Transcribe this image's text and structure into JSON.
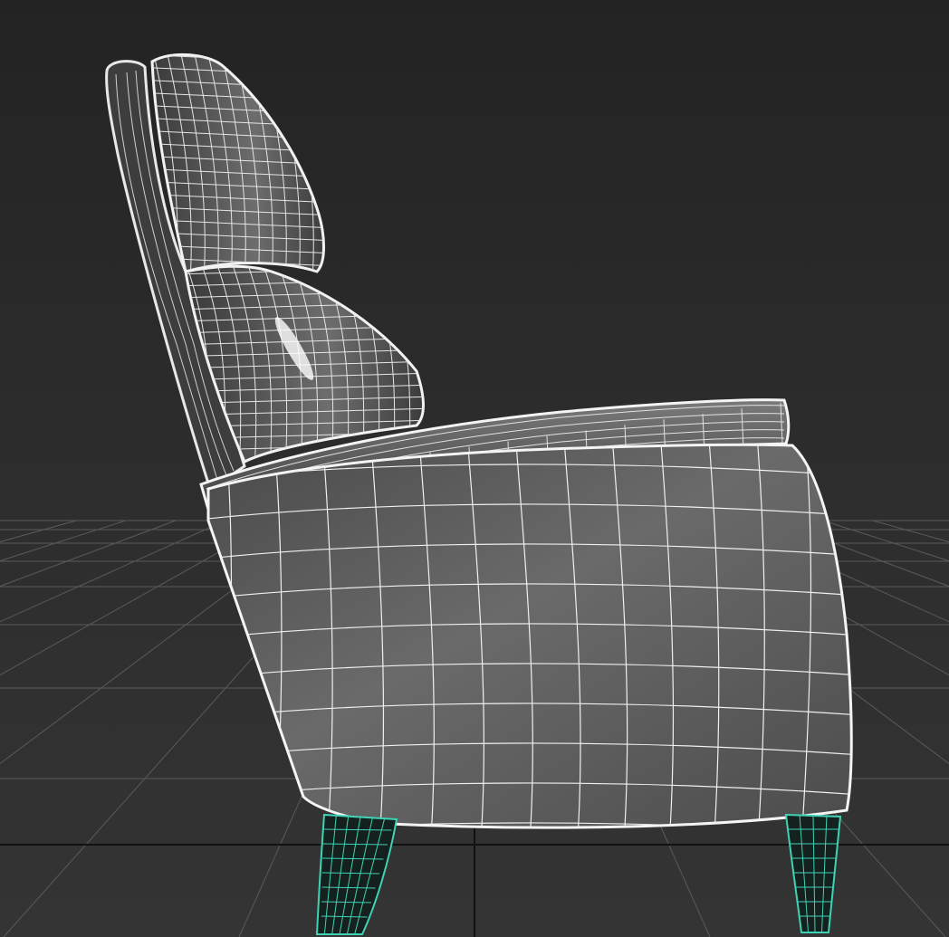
{
  "viewport": {
    "background_top": "#232323",
    "background_bottom": "#343434",
    "grid_color": "#5a5a5a",
    "axis_line_color": "#111111",
    "wire_color": "#ffffff",
    "shaded_surface": "#5e5e5e",
    "selected_wire_color": "#3fd2b4",
    "selected_surface": "#15211e"
  },
  "scene": {
    "object": "armchair",
    "display_mode": "smooth-shaded-with-edged-faces",
    "selected_parts": [
      "front-leg",
      "back-leg"
    ],
    "view": "side"
  }
}
